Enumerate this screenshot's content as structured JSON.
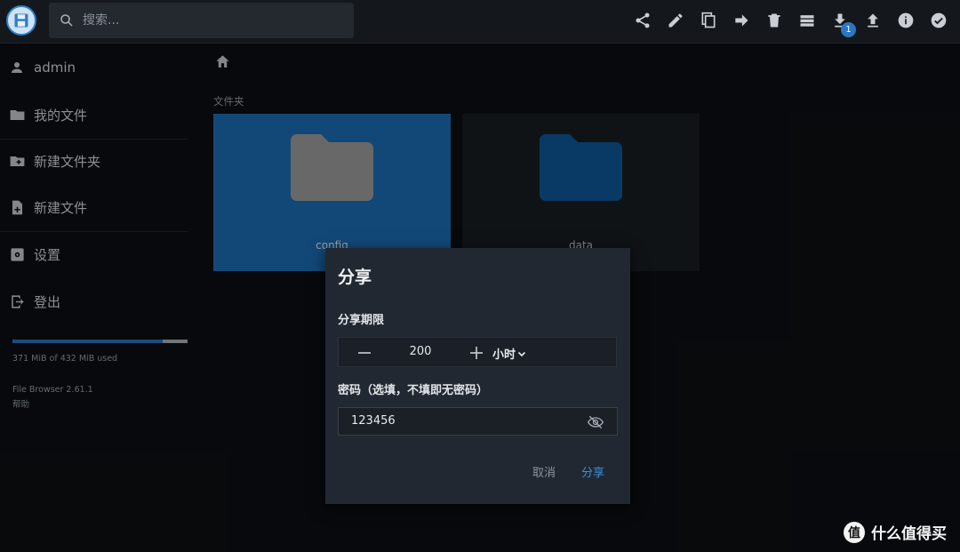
{
  "search": {
    "placeholder": "搜索..."
  },
  "toolbar": {
    "icons": [
      "share-icon",
      "edit-icon",
      "copy-icon",
      "move-icon",
      "delete-icon",
      "view-list-icon",
      "download-icon",
      "upload-icon",
      "info-icon",
      "select-icon"
    ],
    "download_badge": "1"
  },
  "sidebar": {
    "user": "admin",
    "items": [
      {
        "label": "我的文件",
        "icon": "folder-icon"
      },
      {
        "label": "新建文件夹",
        "icon": "new-folder-icon"
      },
      {
        "label": "新建文件",
        "icon": "new-file-icon"
      },
      {
        "label": "设置",
        "icon": "settings-icon"
      },
      {
        "label": "登出",
        "icon": "logout-icon"
      }
    ],
    "usage_text": "371 MiB of 432 MiB used",
    "usage_fraction": 0.859,
    "version": "File Browser 2.61.1",
    "help": "帮助"
  },
  "main": {
    "breadcrumb_icon": "home-icon",
    "section_title": "文件夹",
    "folders": [
      {
        "name": "config",
        "selected": true
      },
      {
        "name": "data",
        "selected": false
      }
    ]
  },
  "dialog": {
    "title": "分享",
    "expiry_label": "分享期限",
    "expiry_value": "200",
    "expiry_unit": "小时",
    "password_label": "密码（选填，不填即无密码）",
    "password_value": "123456",
    "cancel_label": "取消",
    "share_label": "分享"
  },
  "watermark": {
    "glyph": "值",
    "text": "什么值得买"
  },
  "colors": {
    "accent": "#2f80c6",
    "selected_card": "#1d6fb8",
    "folder_blue": "#0f5a9c",
    "folder_gray": "#a0a0a0"
  }
}
